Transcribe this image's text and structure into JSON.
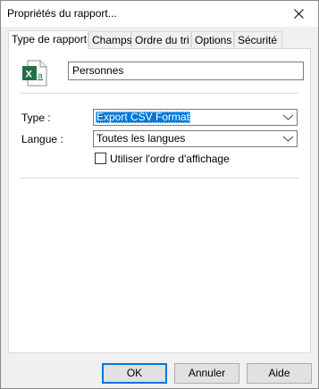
{
  "window": {
    "title": "Propriétés du rapport..."
  },
  "tabs": [
    {
      "label": "Type de rapport",
      "active": true
    },
    {
      "label": "Champs",
      "active": false
    },
    {
      "label": "Ordre du tri",
      "active": false
    },
    {
      "label": "Options",
      "active": false
    },
    {
      "label": "Sécurité",
      "active": false
    }
  ],
  "report": {
    "icon": "excel-file-icon",
    "name_value": "Personnes"
  },
  "form": {
    "type_label": "Type :",
    "type_value": "Export CSV Format",
    "language_label": "Langue :",
    "language_value": "Toutes les langues",
    "display_order_label": "Utiliser l'ordre d'affichage",
    "display_order_checked": false
  },
  "buttons": {
    "ok_label": "OK",
    "cancel_label": "Annuler",
    "help_label": "Aide"
  },
  "colors": {
    "selection": "#0078d7",
    "excel_green": "#1e7145"
  }
}
